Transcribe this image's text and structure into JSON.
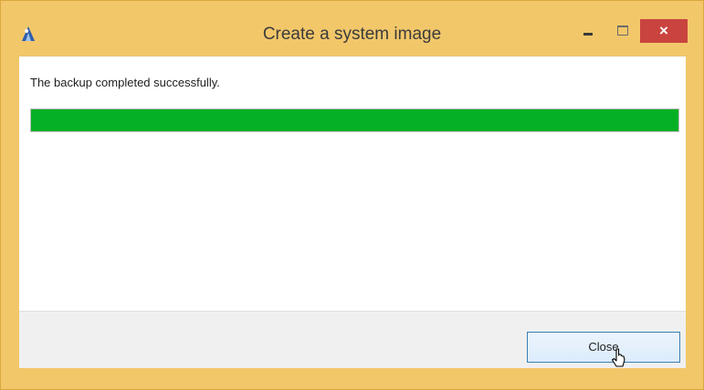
{
  "window": {
    "title": "Create a system image",
    "close_glyph": "×"
  },
  "content": {
    "message": "The backup completed successfully.",
    "progress_percent": 100
  },
  "footer": {
    "close_label": "Close"
  },
  "colors": {
    "frame": "#f2c76a",
    "progress_fill": "#06b025",
    "close_button_border": "#3c7fb1",
    "title_close_bg": "#c9443f"
  },
  "icons": {
    "app": "system-image-backup-icon",
    "minimize": "minimize-icon",
    "maximize": "maximize-icon",
    "close": "close-icon",
    "cursor": "mouse-pointer-icon"
  }
}
